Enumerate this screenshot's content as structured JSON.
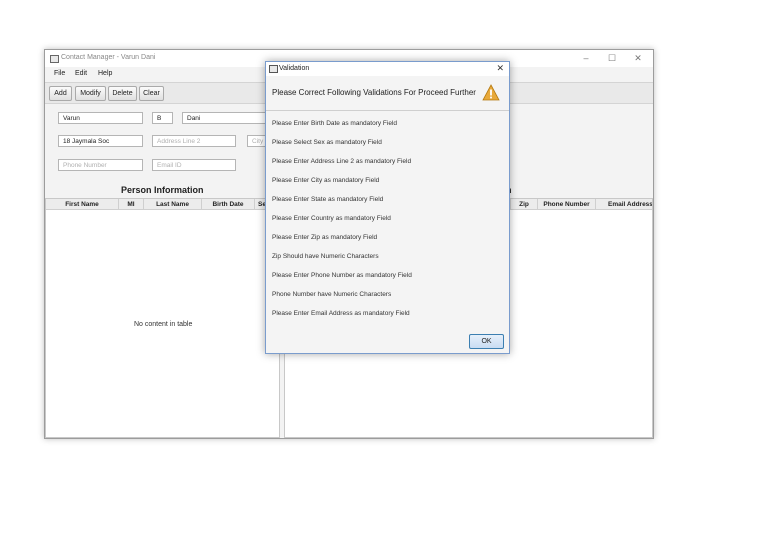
{
  "window": {
    "title": "Contact Manager - Varun Dani",
    "controls": {
      "minimize": "–",
      "maximize": "☐",
      "close": "✕"
    }
  },
  "menu": [
    "File",
    "Edit",
    "Help"
  ],
  "toolbar": {
    "buttons": [
      "Add",
      "Modify",
      "Delete",
      "Clear"
    ]
  },
  "form": {
    "first_name": "Varun",
    "middle_initial": "B",
    "last_name": "Dani",
    "address_line_1": "18 Jaymala Soc",
    "address_line_2_placeholder": "Address Line 2",
    "city_placeholder": "City",
    "phone_placeholder": "Phone Number",
    "email_placeholder": "Email ID"
  },
  "left_table": {
    "title": "Person Information",
    "columns": [
      "First Name",
      "MI",
      "Last Name",
      "Birth Date",
      "Se"
    ],
    "empty_message": "No content in table"
  },
  "right_table": {
    "title_fragment": "n",
    "columns": [
      "Zip",
      "Phone Number",
      "Email Address"
    ]
  },
  "dialog": {
    "title": "Validation",
    "close": "✕",
    "header": "Please Correct Following Validations For Proceed Further",
    "icon": "warning-icon",
    "messages": [
      "Please Enter Birth Date as mandatory Field",
      "Please Select Sex as mandatory Field",
      "Please Enter Address Line 2 as mandatory Field",
      "Please Enter City as mandatory Field",
      "Please Enter State as mandatory Field",
      "Please Enter Country as mandatory Field",
      "Please Enter Zip as mandatory Field",
      "Zip Should have Numeric Characters",
      "Please Enter Phone Number as mandatory Field",
      "Phone Number have Numeric Characters",
      "Please Enter Email Address as mandatory Field"
    ],
    "ok_label": "OK"
  },
  "colors": {
    "accent": "#3c7fb1",
    "warning": "#e8a93a"
  }
}
